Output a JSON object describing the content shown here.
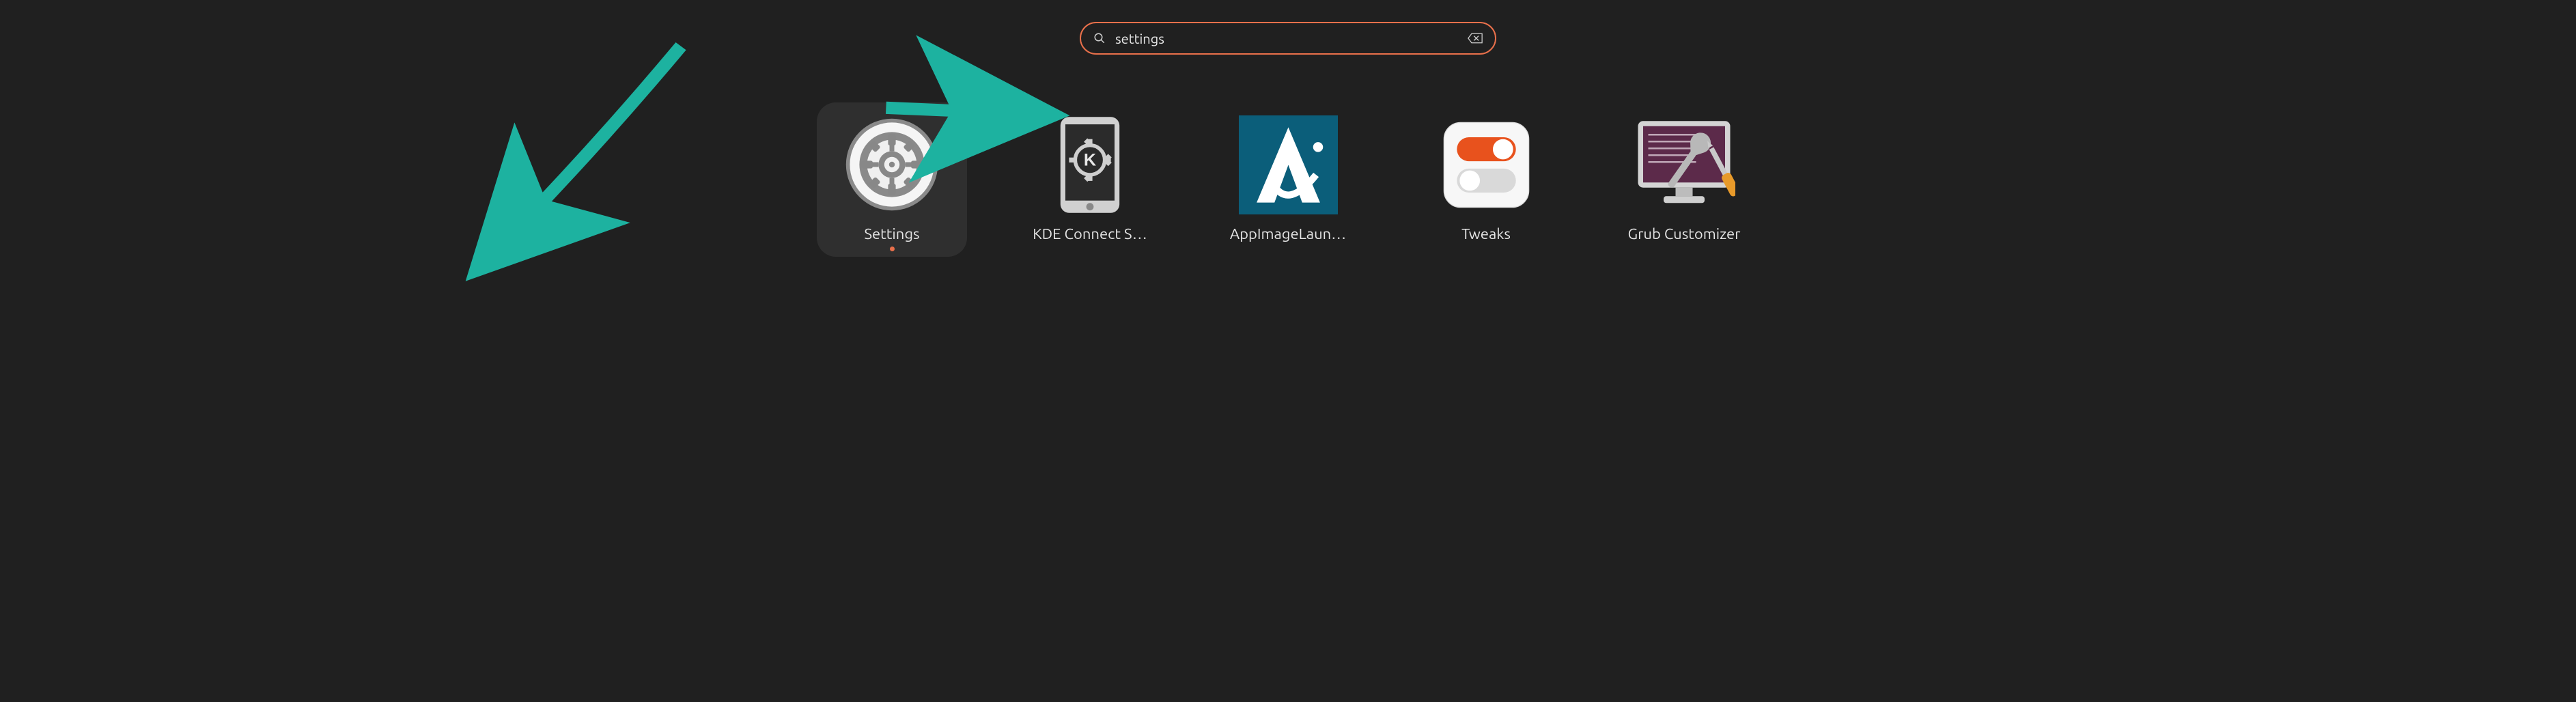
{
  "search": {
    "value": "settings",
    "placeholder": ""
  },
  "apps": [
    {
      "label": "Settings",
      "icon": "settings",
      "selected": true,
      "running": true
    },
    {
      "label": "KDE Connect S…",
      "icon": "kde-connect",
      "selected": false,
      "running": false
    },
    {
      "label": "AppImageLaun…",
      "icon": "appimage",
      "selected": false,
      "running": false
    },
    {
      "label": "Tweaks",
      "icon": "tweaks",
      "selected": false,
      "running": false
    },
    {
      "label": "Grub Customizer",
      "icon": "grub-customizer",
      "selected": false,
      "running": false
    }
  ],
  "annotations": {
    "arrow_color": "#1db2a0"
  }
}
